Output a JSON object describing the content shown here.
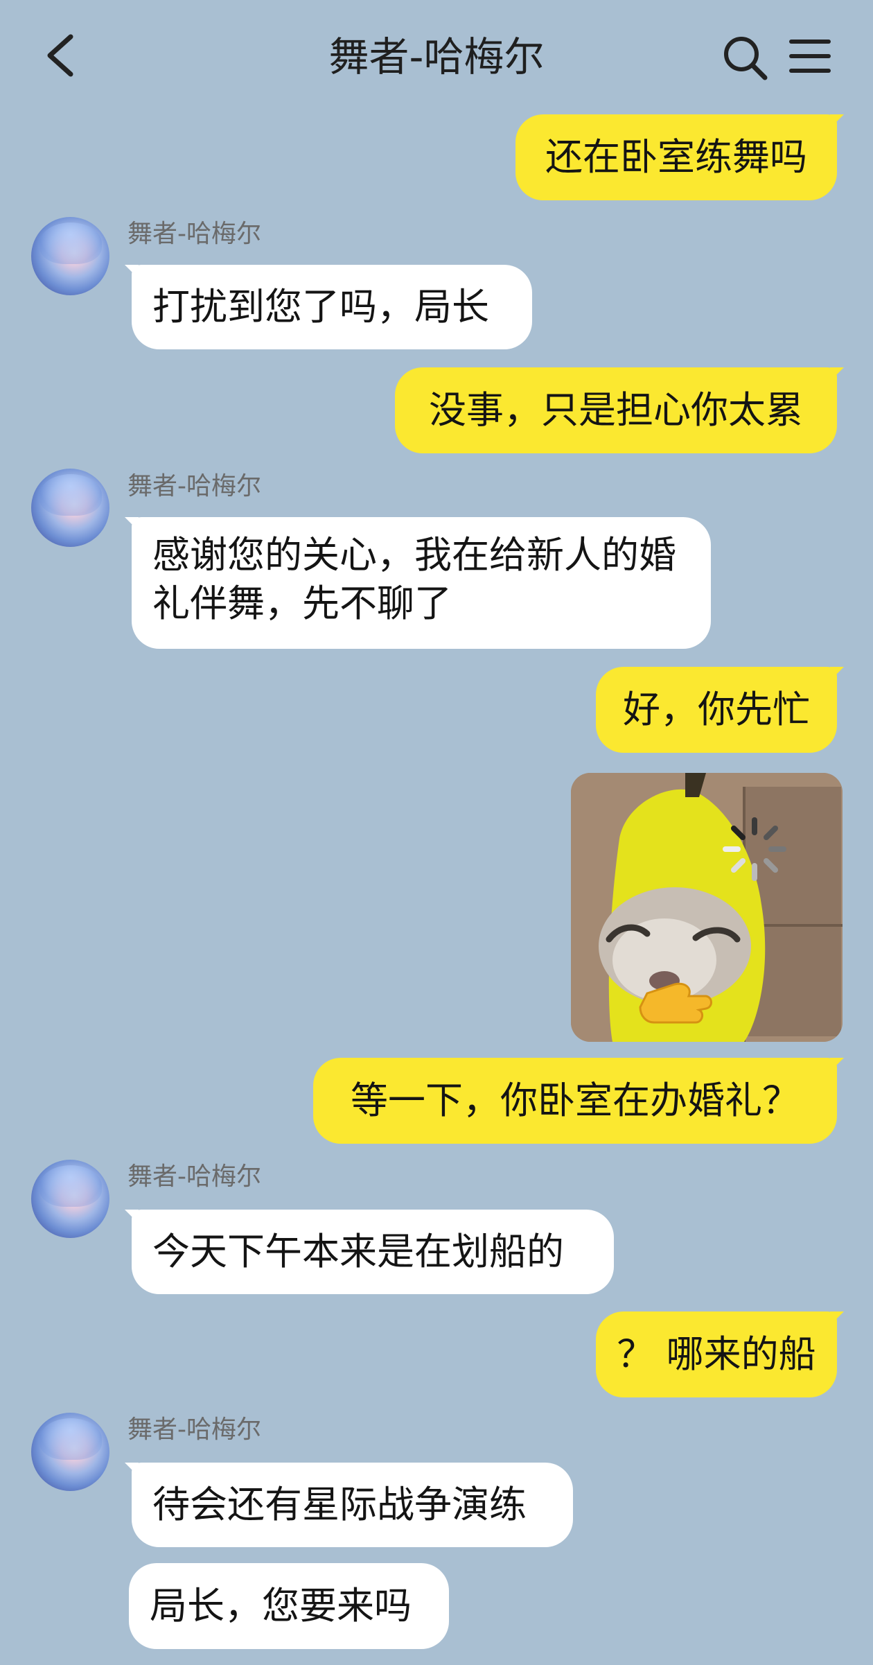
{
  "header": {
    "title": "舞者-哈梅尔"
  },
  "contact": {
    "name": "舞者-哈梅尔"
  },
  "messages": [
    {
      "side": "out",
      "text": "还在卧室练舞吗"
    },
    {
      "side": "in",
      "text": "打扰到您了吗，局长"
    },
    {
      "side": "out",
      "text": "没事，只是担心你太累"
    },
    {
      "side": "in",
      "text": "感谢您的关心，我在给新人的婚礼伴舞，先不聊了"
    },
    {
      "side": "out",
      "text": "好，你先忙"
    },
    {
      "side": "out",
      "type": "sticker",
      "sticker": "banana-cat-sticker"
    },
    {
      "side": "out",
      "text": "等一下，你卧室在办婚礼？"
    },
    {
      "side": "in",
      "text": "今天下午本来是在划船的"
    },
    {
      "side": "out",
      "text": "？ 哪来的船"
    },
    {
      "side": "in",
      "text": "待会还有星际战争演练"
    },
    {
      "side": "in",
      "text": "局长，您要来吗"
    }
  ],
  "colors": {
    "background": "#a9bfd2",
    "outgoing_bubble": "#fbe830",
    "incoming_bubble": "#ffffff"
  },
  "icons": [
    "back-arrow-icon",
    "search-icon",
    "menu-icon",
    "avatar"
  ]
}
